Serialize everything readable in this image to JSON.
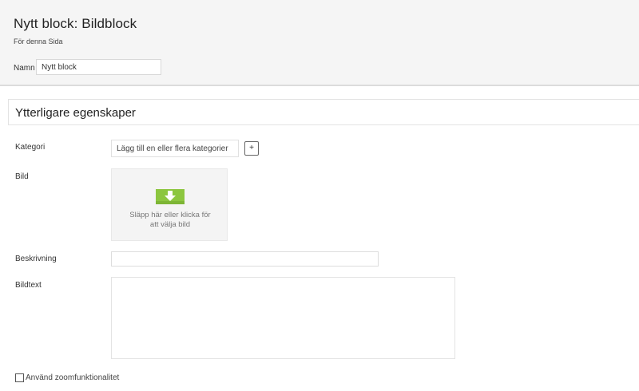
{
  "header": {
    "title": "Nytt block: Bildblock",
    "subtitle": "För denna Sida",
    "name_label": "Namn",
    "name_value": "Nytt block"
  },
  "section": {
    "title": "Ytterligare egenskaper"
  },
  "fields": {
    "category": {
      "label": "Kategori",
      "placeholder": "Lägg till en eller flera kategorier",
      "add_label": "+"
    },
    "image": {
      "label": "Bild",
      "drop_text_line1": "Släpp här eller klicka för",
      "drop_text_line2": "att välja bild",
      "icon": "download-arrow-icon",
      "icon_color": "#8cc63f"
    },
    "description": {
      "label": "Beskrivning",
      "value": ""
    },
    "caption": {
      "label": "Bildtext",
      "value": ""
    },
    "zoom": {
      "label": "Använd zoomfunktionalitet",
      "checked": false
    }
  }
}
